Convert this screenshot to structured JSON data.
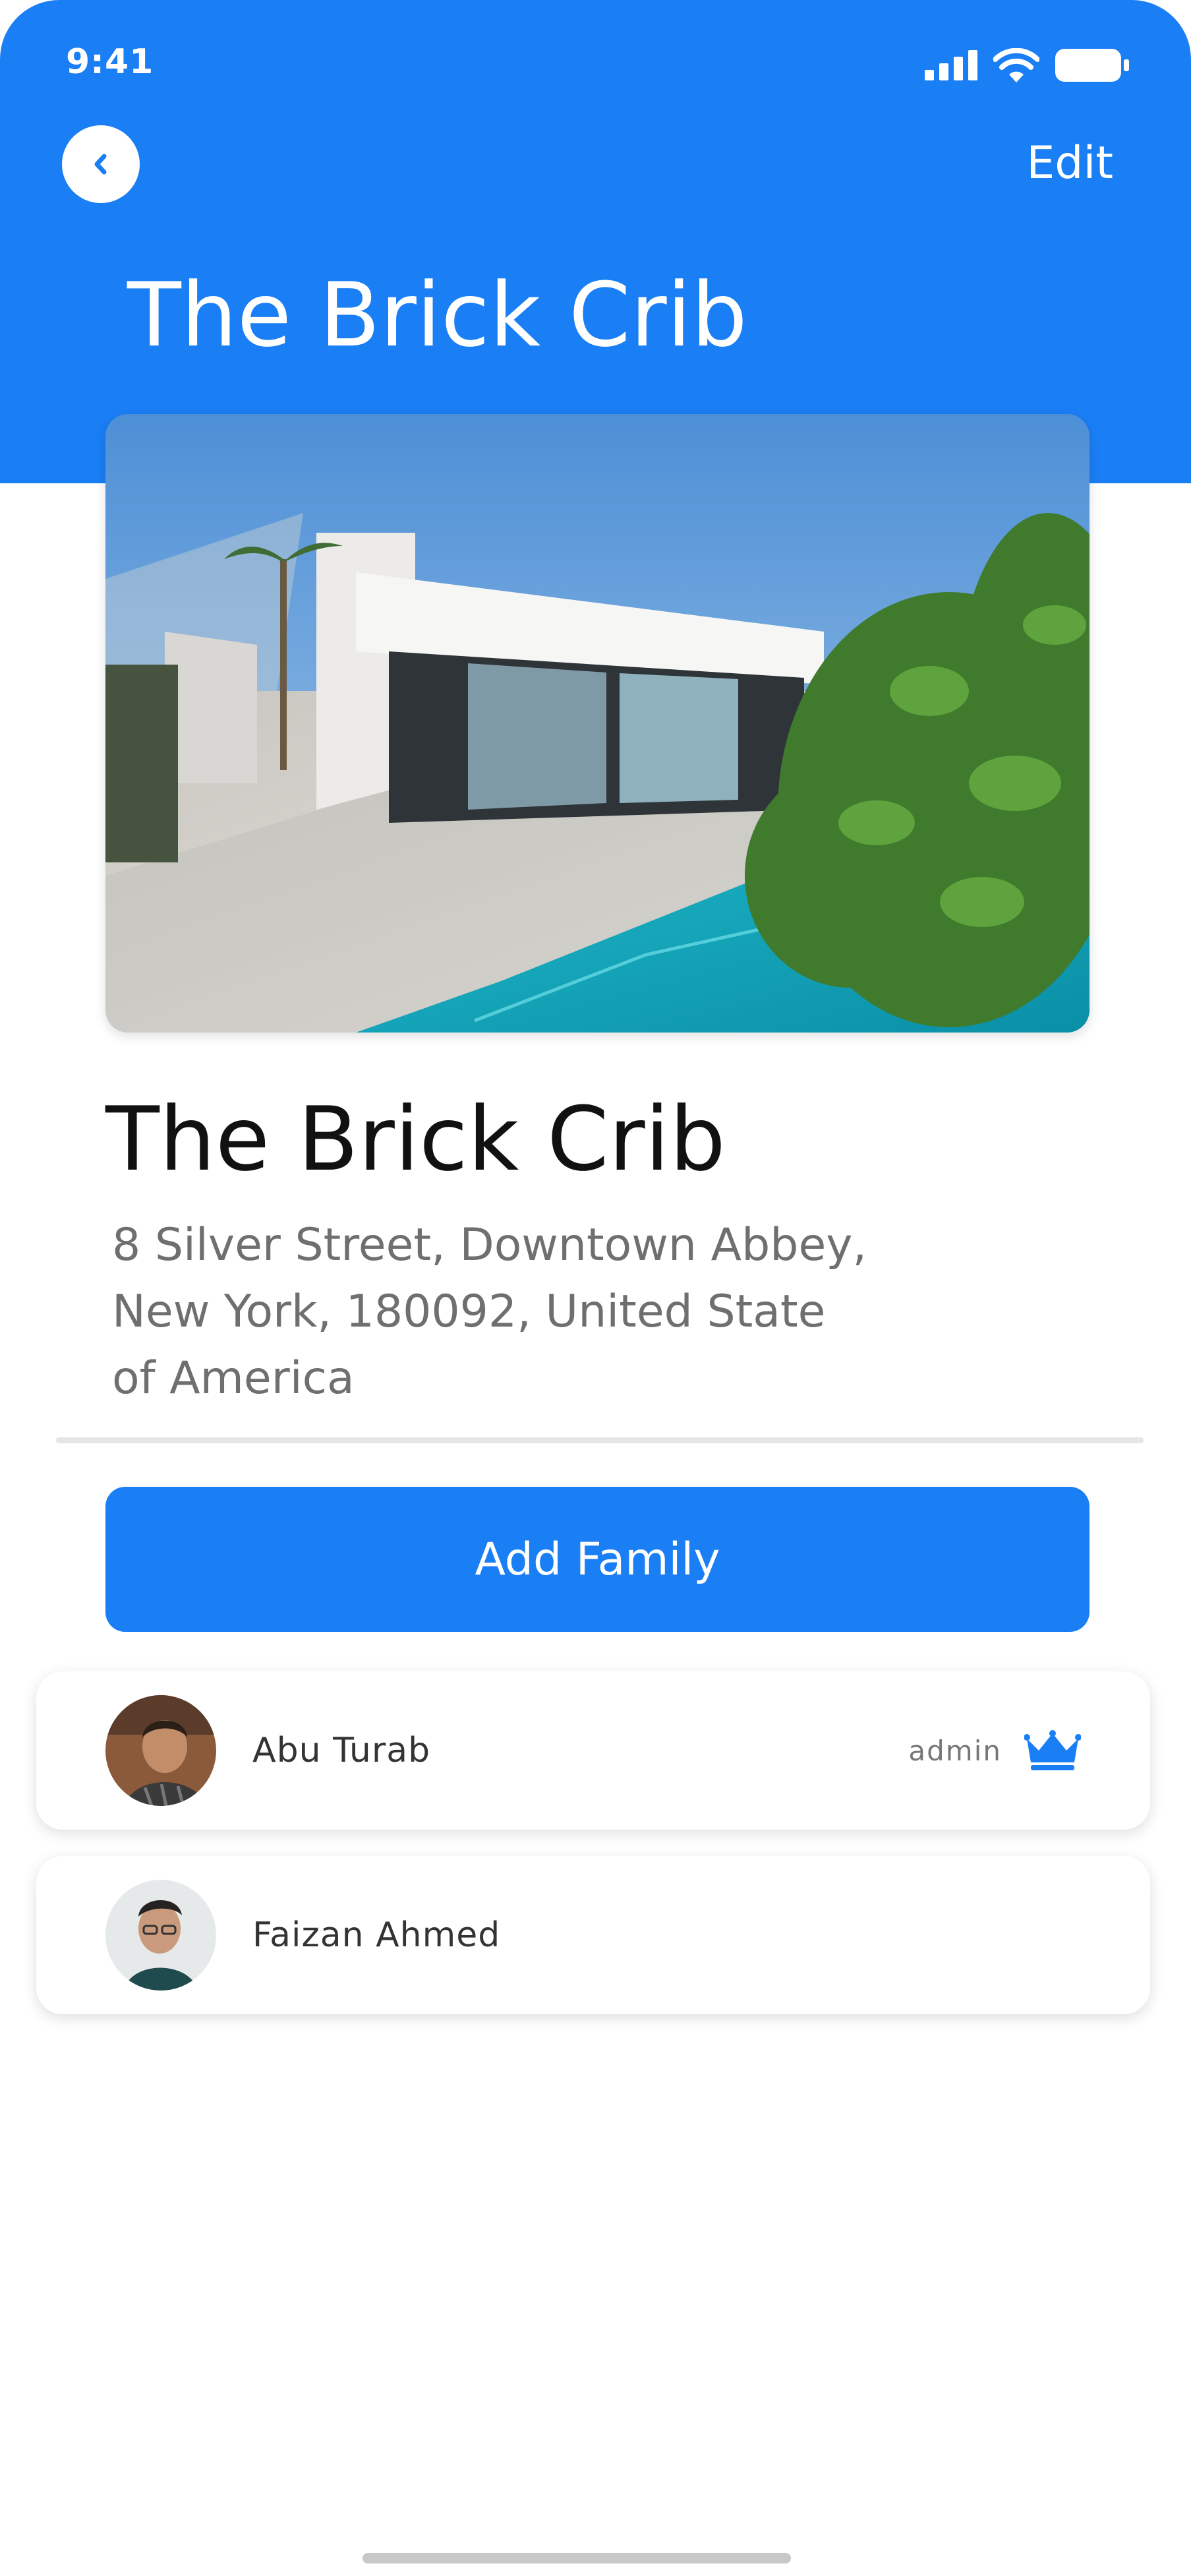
{
  "status_bar": {
    "time": "9:41"
  },
  "header": {
    "edit_label": "Edit",
    "title": "The Brick Crib"
  },
  "property": {
    "name": "The Brick Crib",
    "address_lines": [
      "8 Silver Street, Downtown Abbey,",
      "New York, 180092, United State",
      "of America"
    ]
  },
  "add_family_label": "Add Family",
  "members": [
    {
      "name": "Abu Turab",
      "role": "admin",
      "role_icon": "crown-icon"
    },
    {
      "name": "Faizan Ahmed"
    }
  ],
  "colors": {
    "accent": "#1a7ef5"
  }
}
